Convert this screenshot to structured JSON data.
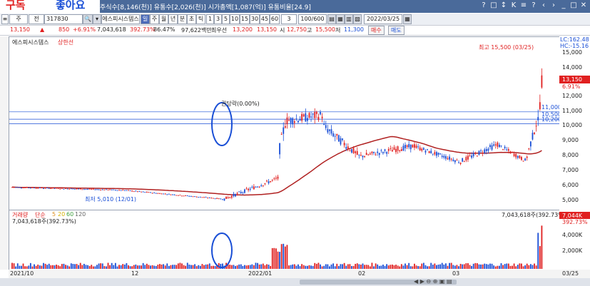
{
  "banner": {
    "left": "구독",
    "right": "좋아요"
  },
  "infobar": {
    "text": "주식수[8,146(천)] 유통수[2,026(천)] 시가총액[1,087(억)] 유통비율[24.9]"
  },
  "window_buttons": [
    "?",
    "□",
    "↕",
    "K",
    "≡",
    "?",
    "‹",
    "›",
    "_",
    "□",
    "✕"
  ],
  "toolbar": {
    "type": "주",
    "mode": "전",
    "code": "317830",
    "name": "에스피시스템스",
    "period_buttons": [
      "일",
      "주",
      "월",
      "년",
      "분",
      "초",
      "틱"
    ],
    "numbers": [
      "1",
      "3",
      "5",
      "10",
      "15",
      "30",
      "45",
      "60"
    ],
    "count": "3",
    "ratio": "100/600",
    "date": "2022/03/25"
  },
  "quote": {
    "price": "13,150",
    "change": "850",
    "change_pct": "+6.91%",
    "volume": "7,043,618",
    "vol_pct": "392.73%",
    "ratio": "86.47%",
    "amount": "97,622백만",
    "ma_label": "최우선",
    "ask": "13,200",
    "bid": "13,150",
    "open_label": "시",
    "open": "12,750",
    "high_label": "고",
    "high": "15,500",
    "low_label": "저",
    "low": "11,300",
    "buy": "매수",
    "sell": "매도"
  },
  "price_panel": {
    "title": "에스피시스템스",
    "subtitle": "상한선",
    "high_note": "최고 15,500 (03/25)",
    "low_note": "최저 5,010 (12/01)",
    "ex_rights": "권당락(0.00%)",
    "lines": [
      "11,000",
      "10,500",
      "10,200"
    ],
    "lc": "LC:162.48",
    "hc": "HC:-15.16",
    "current": "13,150",
    "current_pct": "6.91%",
    "axis": [
      "15,000",
      "14,000",
      "13,000",
      "12,000",
      "11,000",
      "10,000",
      "9,000",
      "8,000",
      "7,000",
      "6,000",
      "5,000"
    ]
  },
  "vol_panel": {
    "title": "거래량",
    "ma": "단순",
    "ma_periods": [
      "5",
      "20",
      "60",
      "120"
    ],
    "value": "7,043,618주(392.73%)",
    "top_right": "7,043,618주(392.73%)",
    "current": "7,044K",
    "current_pct": "392.73%",
    "axis": [
      "4,000K",
      "2,000K"
    ]
  },
  "dates": [
    "2021/10",
    "12",
    "2022/01",
    "02",
    "03",
    "03/25"
  ],
  "colors": {
    "up": "#e02020",
    "down": "#1a4fd6",
    "ma": "#b02020",
    "header": "#4a6a9a"
  }
}
